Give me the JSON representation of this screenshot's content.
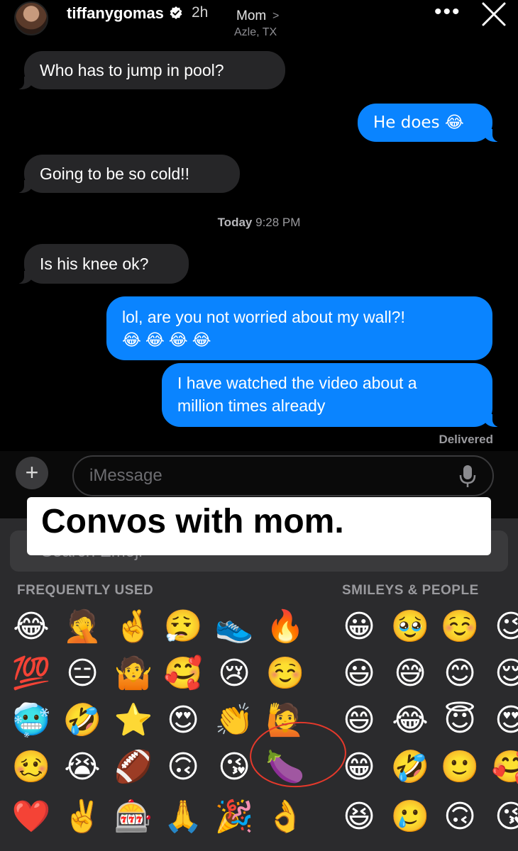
{
  "story": {
    "username": "tiffanygomas",
    "time": "2h"
  },
  "conversation": {
    "contact_name": "Mom",
    "contact_chevron": ">",
    "contact_location": "Azle, TX",
    "messages": [
      {
        "direction": "in",
        "text": "Who has to jump in pool?"
      },
      {
        "direction": "out",
        "text": "He does 😂"
      },
      {
        "direction": "in",
        "text": "Going to be so cold!!"
      },
      {
        "direction": "in",
        "text": "Is his knee ok?"
      },
      {
        "direction": "out",
        "text": "lol, are you not worried about my wall?!"
      },
      {
        "direction": "out",
        "text": "😂😂😂😂"
      },
      {
        "direction": "out",
        "text": "I have watched the video about a"
      },
      {
        "direction": "out",
        "text": "million times already"
      }
    ],
    "timestamp_day": "Today",
    "timestamp_time": "9:28 PM",
    "delivered": "Delivered"
  },
  "input": {
    "placeholder": "iMessage",
    "plus": "+"
  },
  "keyboard": {
    "search_placeholder": "Search Emoji",
    "section_frequent": "FREQUENTLY USED",
    "section_smileys": "SMILEYS & PEOPLE",
    "frequent_rows": [
      [
        "😂",
        "🤦",
        "🤞",
        "😮‍💨",
        "👟",
        "🔥"
      ],
      [
        "💯",
        "😑",
        "🤷",
        "🥰",
        "😢",
        "☺️"
      ],
      [
        "🥶",
        "🤣",
        "⭐",
        "😍",
        "👏",
        "🙋"
      ],
      [
        "🥴",
        "😭",
        "🏈",
        "🙃",
        "😘",
        "🍆"
      ],
      [
        "❤️",
        "✌️",
        "🎰",
        "🙏",
        "🎉",
        "👌"
      ]
    ],
    "smiley_rows": [
      [
        "😀",
        "🥹",
        "☺️",
        "😉"
      ],
      [
        "😃",
        "😅",
        "😊",
        "😌"
      ],
      [
        "😄",
        "😂",
        "😇",
        "😍"
      ],
      [
        "😁",
        "🤣",
        "🙂",
        "🥰"
      ],
      [
        "😆",
        "🥲",
        "🙃",
        "😘"
      ]
    ]
  },
  "caption": {
    "text": "Convos with mom.",
    "emoji": "😂"
  },
  "colors": {
    "sent_bubble": "#0a84ff",
    "received_bubble": "#262628",
    "annotation": "#e5392b"
  }
}
